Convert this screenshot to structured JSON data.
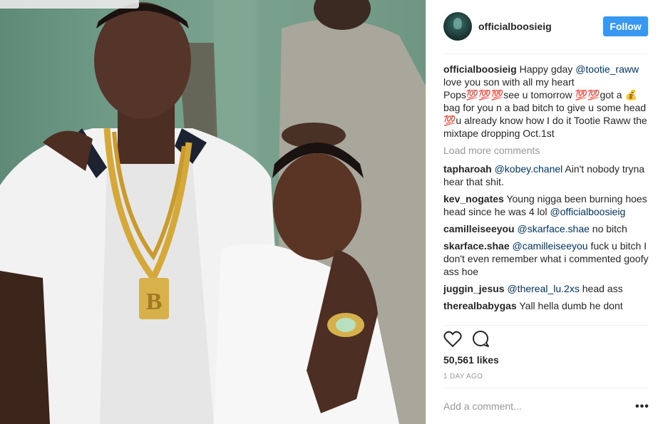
{
  "post": {
    "username": "officialboosieig",
    "follow_label": "Follow",
    "caption": {
      "user": "officialboosieig",
      "text_before": "Happy gday ",
      "mention": "@tootie_raww",
      "text_after": " love you son with all my heart Pops💯💯💯see u tomorrow 💯💯got a 💰bag for you n a bad bitch to give u some head 💯u already know how I do it Tootie Raww the mixtape dropping Oct.1st"
    },
    "load_more_label": "Load more comments",
    "comments": [
      {
        "user": "tapharoah",
        "mention": "@kobey.chanel",
        "text": " Ain't nobody tryna hear that shit."
      },
      {
        "user": "kev_nogates",
        "mention": "",
        "text": "Young nigga been burning hoes head since he was 4 lol ",
        "mention_after": "@officialboosieig"
      },
      {
        "user": "camilleiseeyou",
        "mention": "@skarface.shae",
        "text": " no bitch"
      },
      {
        "user": "skarface.shae",
        "mention": "@camilleiseeyou",
        "text": " fuck u bitch I don't even remember what i commented goofy ass hoe"
      },
      {
        "user": "juggin_jesus",
        "mention": "@thereal_lu.2xs",
        "text": " head ass"
      },
      {
        "user": "therealbabygas",
        "mention": "",
        "text": "Yall hella dumb he dont"
      }
    ],
    "likes": "50,561 likes",
    "timestamp": "1 DAY AGO",
    "add_comment_placeholder": "Add a comment...",
    "more_label": "•••",
    "icons": {
      "like": "heart-outline-icon",
      "comment": "comment-bubble-icon",
      "more": "more-options-icon"
    }
  }
}
